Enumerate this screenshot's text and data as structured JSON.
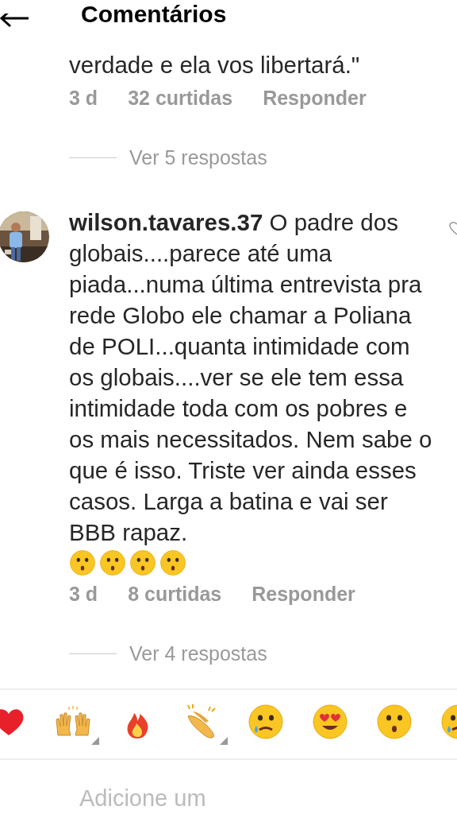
{
  "header": {
    "title": "Comentários"
  },
  "comments": [
    {
      "text": "verdade e ela vos libertará.\"",
      "time": "3 d",
      "likes": "32 curtidas",
      "reply": "Responder",
      "replies": "Ver 5 respostas"
    },
    {
      "text": "**wilson.tavares.37** O padre dos globais....parece até uma piada...numa última entrevista pra rede Globo ele chamar a Poliana de POLI...quanta intimidade com os globais....ver se ele tem essa intimidade toda com os pobres e os mais necessitados. Nem sabe o que é isso. Triste ver ainda esses casos. Larga a batina e vai ser BBB rapaz.",
      "reactions": [
        {
          "kind": "hushed"
        },
        {
          "kind": "hushed"
        },
        {
          "kind": "hushed"
        },
        {
          "kind": "hushed"
        }
      ],
      "time": "3 d",
      "likes": "8 curtidas",
      "reply": "Responder",
      "replies": "Ver 4 respostas"
    }
  ],
  "emoji_bar": [
    {
      "kind": "heart",
      "variants": false
    },
    {
      "kind": "raised-hands",
      "variants": true
    },
    {
      "kind": "fire",
      "variants": false
    },
    {
      "kind": "clap",
      "variants": true
    },
    {
      "kind": "crying",
      "variants": false
    },
    {
      "kind": "heart-eyes",
      "variants": false
    },
    {
      "kind": "hushed",
      "variants": false
    },
    {
      "kind": "crying"
    }
  ],
  "composer": {
    "placeholder": "Adicione um"
  }
}
